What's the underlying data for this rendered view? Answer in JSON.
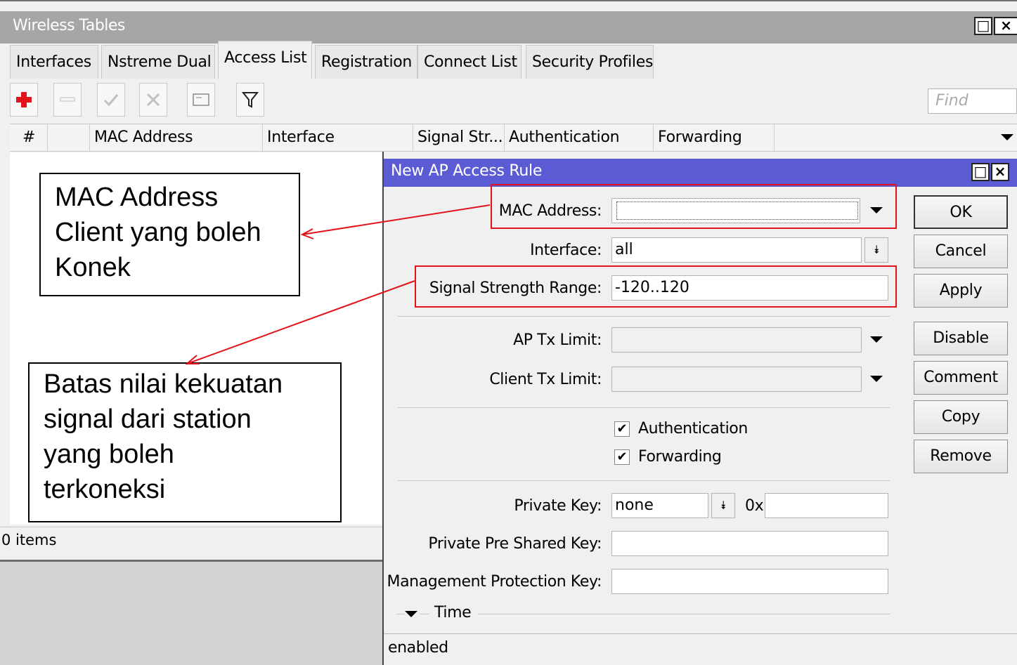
{
  "window": {
    "title": "Wireless Tables",
    "tabs": [
      "Interfaces",
      "Nstreme Dual",
      "Access List",
      "Registration",
      "Connect List",
      "Security Profiles"
    ],
    "active_tab": "Access List",
    "find_placeholder": "Find",
    "columns": [
      "#",
      "MAC Address",
      "Interface",
      "Signal Str...",
      "Authentication",
      "Forwarding"
    ],
    "status": "0 items"
  },
  "dialog": {
    "title": "New AP Access Rule",
    "fields": {
      "mac_address": {
        "label": "MAC Address:",
        "value": ""
      },
      "interface": {
        "label": "Interface:",
        "value": "all"
      },
      "signal_strength_range": {
        "label": "Signal Strength Range:",
        "value": "-120..120"
      },
      "ap_tx_limit": {
        "label": "AP Tx Limit:",
        "value": ""
      },
      "client_tx_limit": {
        "label": "Client Tx Limit:",
        "value": ""
      },
      "authentication": {
        "label": "Authentication",
        "checked": true
      },
      "forwarding": {
        "label": "Forwarding",
        "checked": true
      },
      "private_key": {
        "label": "Private Key:",
        "value": "none",
        "prefix": "0x",
        "hex_value": ""
      },
      "private_pre_shared_key": {
        "label": "Private Pre Shared Key:",
        "value": ""
      },
      "management_protection_key": {
        "label": "Management Protection Key:",
        "value": ""
      },
      "time_section": "Time"
    },
    "buttons": [
      "OK",
      "Cancel",
      "Apply",
      "Disable",
      "Comment",
      "Copy",
      "Remove"
    ],
    "status": "enabled"
  },
  "callouts": {
    "mac_lines": [
      "MAC Address",
      "Client yang boleh",
      "Konek"
    ],
    "signal_lines": [
      "Batas nilai kekuatan",
      "signal dari station",
      "yang boleh",
      "terkoneksi"
    ]
  },
  "colors": {
    "title_bar_inactive": "#a6a6a6",
    "title_bar_active": "#5b5bd3",
    "highlight": "#e2141a",
    "add_icon": "#e0141a"
  }
}
